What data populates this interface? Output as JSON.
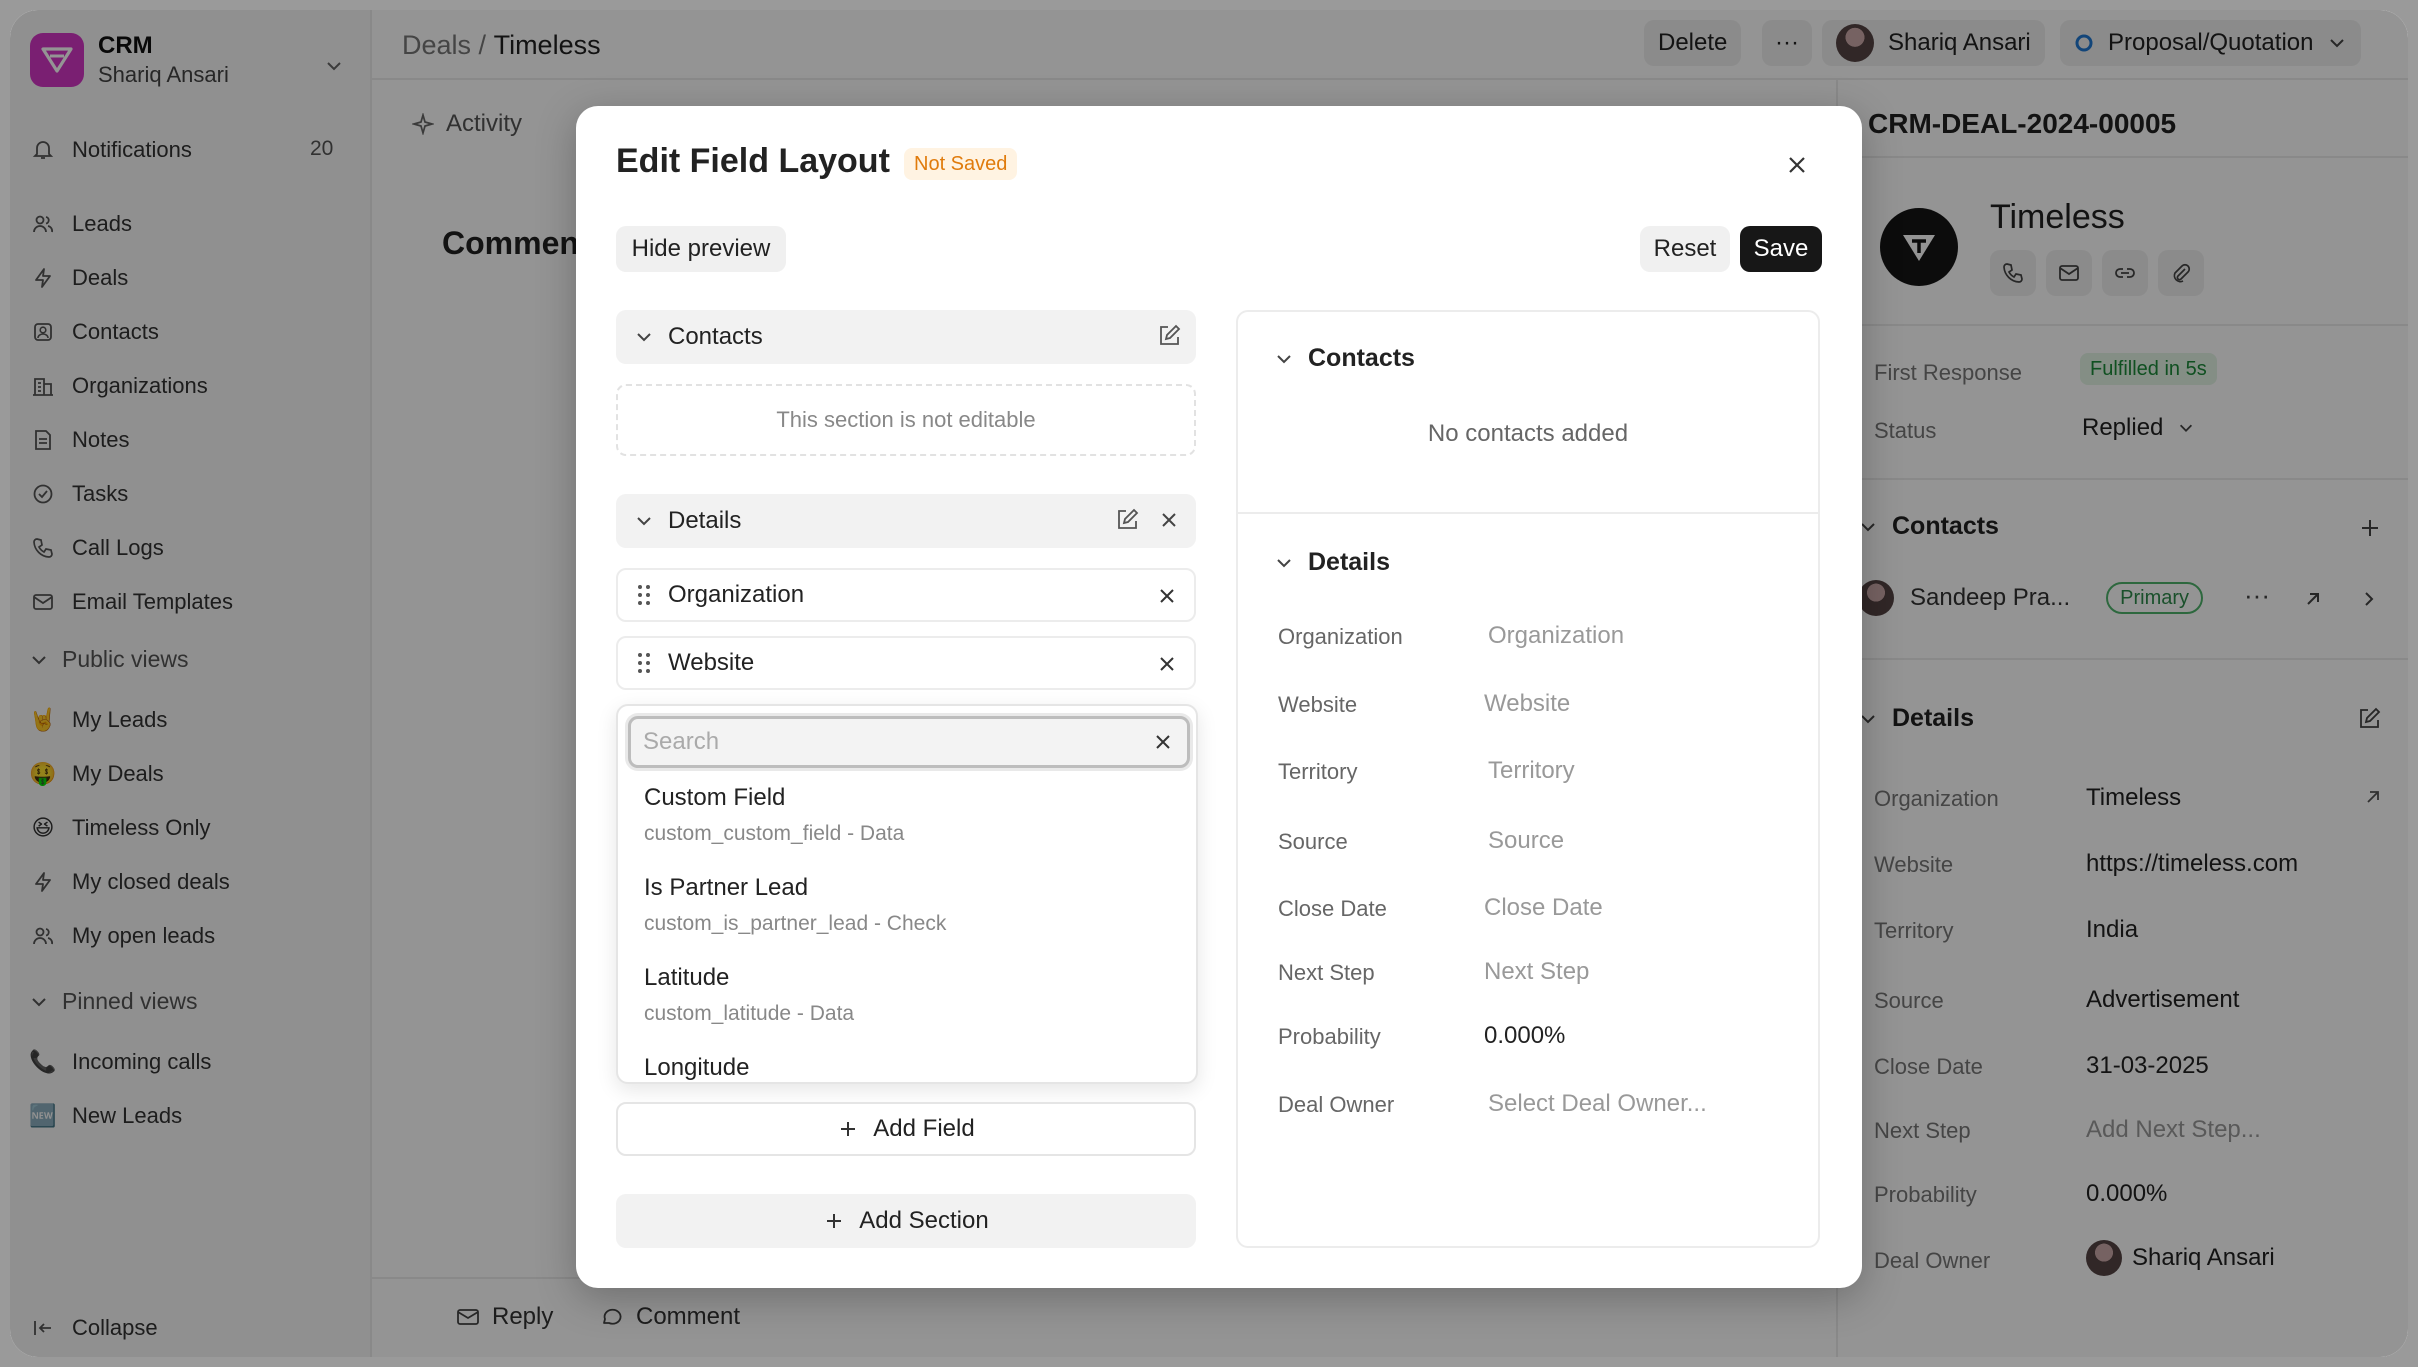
{
  "sidebar": {
    "brand_name": "CRM",
    "brand_user": "Shariq Ansari",
    "notifications_label": "Notifications",
    "notifications_count": "20",
    "nav": [
      "Leads",
      "Deals",
      "Contacts",
      "Organizations",
      "Notes",
      "Tasks",
      "Call Logs",
      "Email Templates"
    ],
    "public_views_label": "Public views",
    "public_views": [
      {
        "emoji": "🤘",
        "label": "My Leads"
      },
      {
        "emoji": "🤑",
        "label": "My Deals"
      },
      {
        "emoji": "😆",
        "label": "Timeless Only"
      },
      {
        "emoji": "",
        "label": "My closed deals"
      },
      {
        "emoji": "",
        "label": "My open leads"
      }
    ],
    "pinned_views_label": "Pinned views",
    "pinned_views": [
      {
        "emoji": "📞",
        "label": "Incoming calls"
      },
      {
        "emoji": "🆕",
        "label": "New Leads"
      }
    ],
    "collapse_label": "Collapse"
  },
  "topbar": {
    "crumb_root": "Deals",
    "crumb_sep": "/",
    "crumb_current": "Timeless",
    "delete_label": "Delete",
    "more_label": "···",
    "owner": "Shariq Ansari",
    "status": "Proposal/Quotation",
    "status_color": "#1f77d0"
  },
  "main": {
    "tab_activity": "Activity",
    "comments_heading": "Commen",
    "reply_label": "Reply",
    "comment_label": "Comment"
  },
  "right_panel": {
    "deal_id": "CRM-DEAL-2024-00005",
    "org_name": "Timeless",
    "first_response_label": "First Response",
    "first_response_value": "Fulfilled in 5s",
    "status_label": "Status",
    "status_value": "Replied",
    "contacts_heading": "Contacts",
    "contact_name": "Sandeep Pra...",
    "contact_badge": "Primary",
    "details_heading": "Details",
    "details": [
      {
        "label": "Organization",
        "value": "Timeless"
      },
      {
        "label": "Website",
        "value": "https://timeless.com"
      },
      {
        "label": "Territory",
        "value": "India"
      },
      {
        "label": "Source",
        "value": "Advertisement"
      },
      {
        "label": "Close Date",
        "value": "31-03-2025"
      },
      {
        "label": "Next Step",
        "value": "Add Next Step..."
      },
      {
        "label": "Probability",
        "value": "0.000%"
      },
      {
        "label": "Deal Owner",
        "value": "Shariq Ansari"
      }
    ]
  },
  "modal": {
    "title": "Edit Field Layout",
    "badge": "Not Saved",
    "hide_preview_label": "Hide preview",
    "reset_label": "Reset",
    "save_label": "Save",
    "sections": {
      "contacts": "Contacts",
      "contacts_note": "This section is not editable",
      "details": "Details"
    },
    "fields": [
      "Organization",
      "Website"
    ],
    "search_placeholder": "Search",
    "search_value": "",
    "options": [
      {
        "label": "Custom Field",
        "sub": "custom_custom_field - Data"
      },
      {
        "label": "Is Partner Lead",
        "sub": "custom_is_partner_lead - Check"
      },
      {
        "label": "Latitude",
        "sub": "custom_latitude - Data"
      },
      {
        "label": "Longitude",
        "sub": ""
      }
    ],
    "add_field_label": "Add Field",
    "add_section_label": "Add Section",
    "preview": {
      "contacts_heading": "Contacts",
      "contacts_empty": "No contacts added",
      "details_heading": "Details",
      "rows": [
        {
          "label": "Organization",
          "value": "Organization"
        },
        {
          "label": "Website",
          "value": "Website"
        },
        {
          "label": "Territory",
          "value": "Territory"
        },
        {
          "label": "Source",
          "value": "Source"
        },
        {
          "label": "Close Date",
          "value": "Close Date"
        },
        {
          "label": "Next Step",
          "value": "Next Step"
        },
        {
          "label": "Probability",
          "value": "0.000%"
        },
        {
          "label": "Deal Owner",
          "value": "Select Deal Owner..."
        }
      ]
    }
  }
}
